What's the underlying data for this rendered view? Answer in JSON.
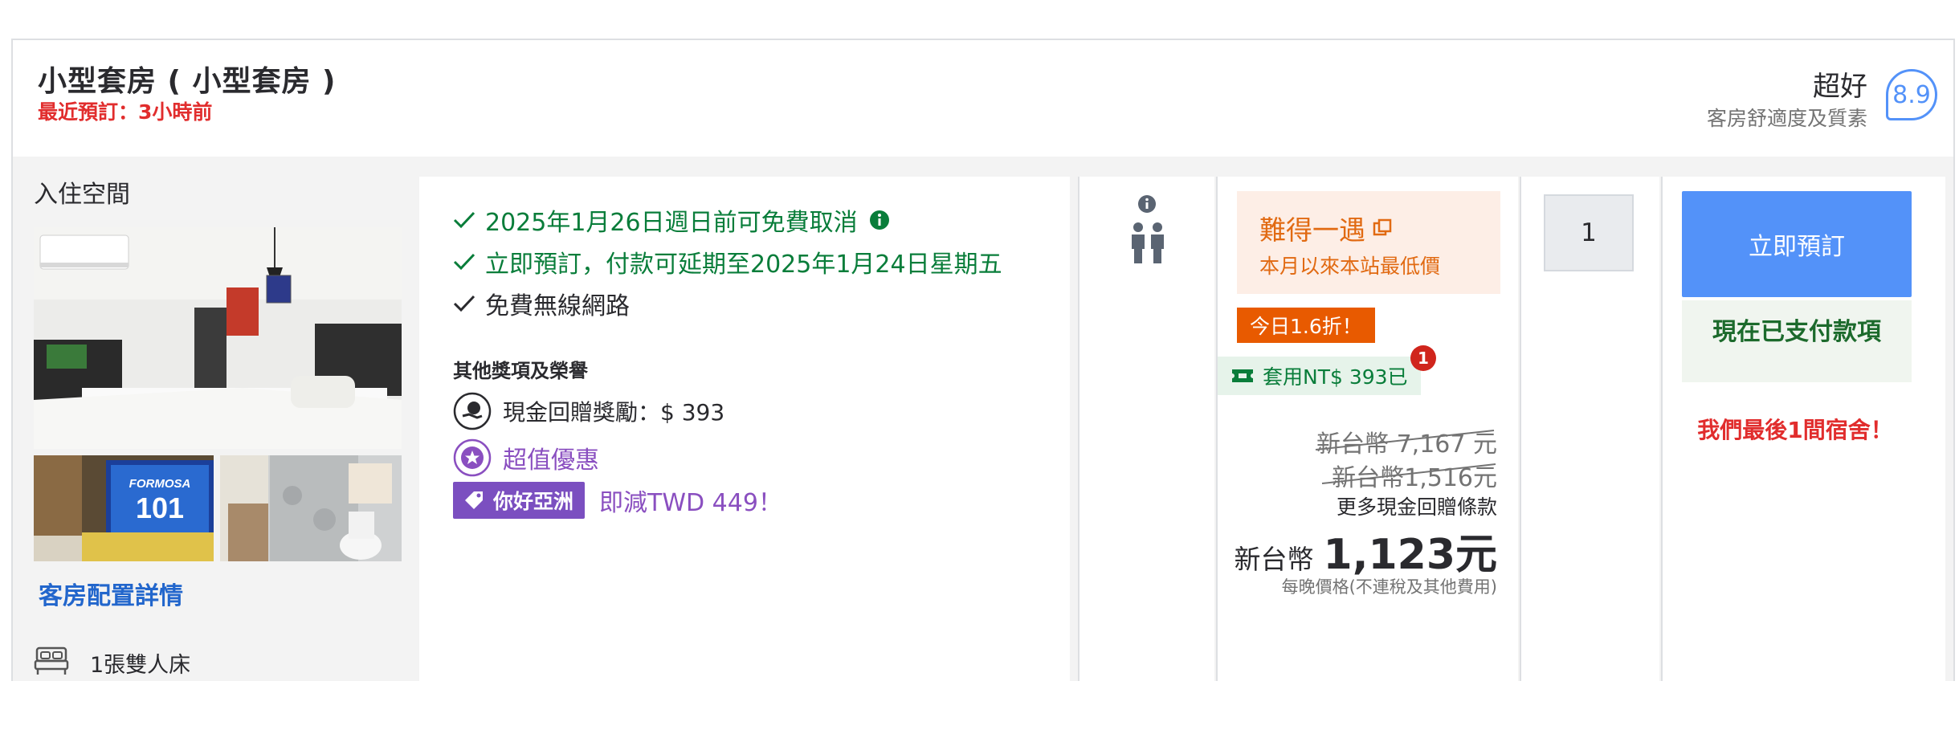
{
  "header": {
    "room_title": "小型套房 ( 小型套房 )",
    "recent_booking": "最近預訂：3小時前",
    "rating_word": "超好",
    "rating_sub": "客房舒適度及質素",
    "rating_score": "8.9"
  },
  "left": {
    "space_label": "入住空間",
    "photo_tv_text": "FORMOSA 101",
    "room_details_link": "客房配置詳情",
    "bed_label": "1張雙人床",
    "icons": {
      "bed": "bed-icon"
    }
  },
  "benefits": {
    "free_cancel": "2025年1月26日週日前可免費取消",
    "pay_later": "立即預訂，付款可延期至2025年1月24日星期五",
    "wifi": "免費無線網路",
    "other_awards_title": "其他獎項及榮譽",
    "cashback": "現金回贈獎勵：$ 393",
    "value_deal": "超值優惠",
    "hello_asia_badge": "你好亞洲",
    "hello_asia_discount": "即減TWD 449！",
    "icons": {
      "check": "check-icon",
      "info": "info-icon",
      "cashback": "cashback-icon",
      "value": "star-badge-icon",
      "tag": "tag-icon"
    }
  },
  "occupancy": {
    "icons": {
      "info": "info-icon",
      "guests": "two-person-icon"
    },
    "guests_count": 2
  },
  "price": {
    "deal_title": "難得一遇",
    "deal_sub": "本月以來本站最低價",
    "today_badge": "今日1.6折！",
    "coupon_text": "套用NT$ 393已",
    "coupon_count": "1",
    "original_price": "新台幣 7,167 元",
    "strike_price": "新台幣1,516元",
    "more_cashback": "更多現金回贈條款",
    "final_currency": "新台幣",
    "final_amount": "1,123元",
    "price_note": "每晚價格(不連稅及其他費用)"
  },
  "quantity": {
    "value": "1"
  },
  "booking": {
    "book_now": "立即預訂",
    "pay_now": "現在已支付款項",
    "last_room": "我們最後1間宿舍！"
  },
  "colors": {
    "accent_blue": "#5392f9",
    "link_blue": "#2266cc",
    "green": "#097d3a",
    "red": "#e12d2d",
    "orange": "#e16a12",
    "purple": "#7b4fc0"
  }
}
